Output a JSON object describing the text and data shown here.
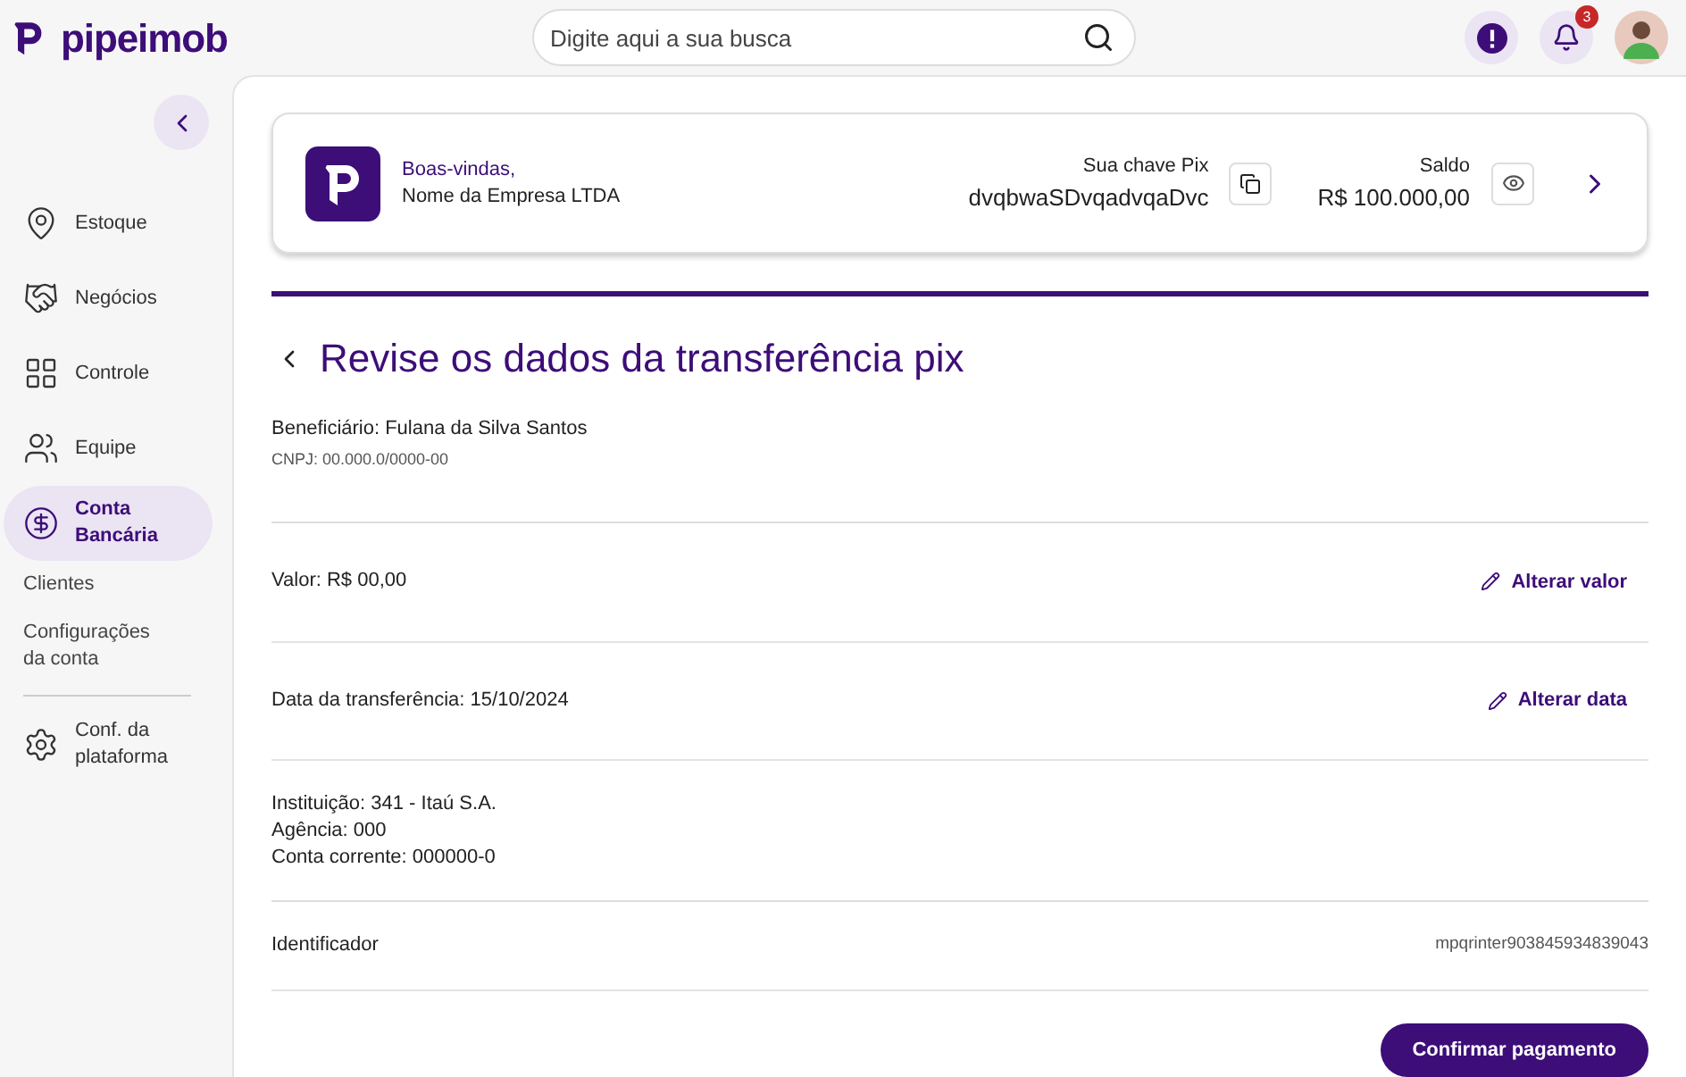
{
  "header": {
    "logo": "pipeimob",
    "search": {
      "placeholder": "Digite aqui a sua busca"
    },
    "notifications": {
      "count": "3"
    }
  },
  "sidebar": {
    "items": [
      {
        "label": "Estoque",
        "kind": "main",
        "selected": false
      },
      {
        "label": "Negócios",
        "kind": "main",
        "selected": false
      },
      {
        "label": "Controle",
        "kind": "main",
        "selected": false
      },
      {
        "label": "Equipe",
        "kind": "main",
        "selected": false
      },
      {
        "label": "Conta Bancária",
        "kind": "main",
        "selected": true
      },
      {
        "label": "Clientes",
        "kind": "sub",
        "selected": false
      },
      {
        "label": "Configurações da conta",
        "kind": "sub",
        "selected": false
      },
      {
        "kind": "divider"
      },
      {
        "label": "Conf. da plataforma",
        "kind": "main",
        "selected": false
      }
    ]
  },
  "account_card": {
    "greeting": "Boas-vindas,",
    "company": "Nome da Empresa LTDA",
    "pix_label": "Sua chave Pix",
    "pix_key": "dvqbwaSDvqadvqaDvc",
    "balance_label": "Saldo",
    "balance": "R$ 100.000,00"
  },
  "title": "Revise os dados da transferência pix",
  "sections": [
    {
      "kind": "beneficiary",
      "lines": [
        "Beneficiário: Fulana da Silva Santos"
      ],
      "note": "CNPJ: 00.000.0/0000-00"
    },
    {
      "kind": "editable",
      "lines": [
        "Valor: R$ 00,00"
      ],
      "action": "Alterar valor"
    },
    {
      "kind": "editable",
      "lines": [
        "Data da transferência: 15/10/2024"
      ],
      "action": "Alterar data"
    },
    {
      "kind": "bank",
      "lines": [
        "Instituição: 341 - Itaú S.A.",
        "Agência: 000",
        "Conta corrente: 000000-0"
      ]
    },
    {
      "kind": "identifier",
      "lines": [
        "Identificador"
      ],
      "value": "mpqrinter903845934839043"
    }
  ],
  "confirm_button": "Confirmar pagamento"
}
